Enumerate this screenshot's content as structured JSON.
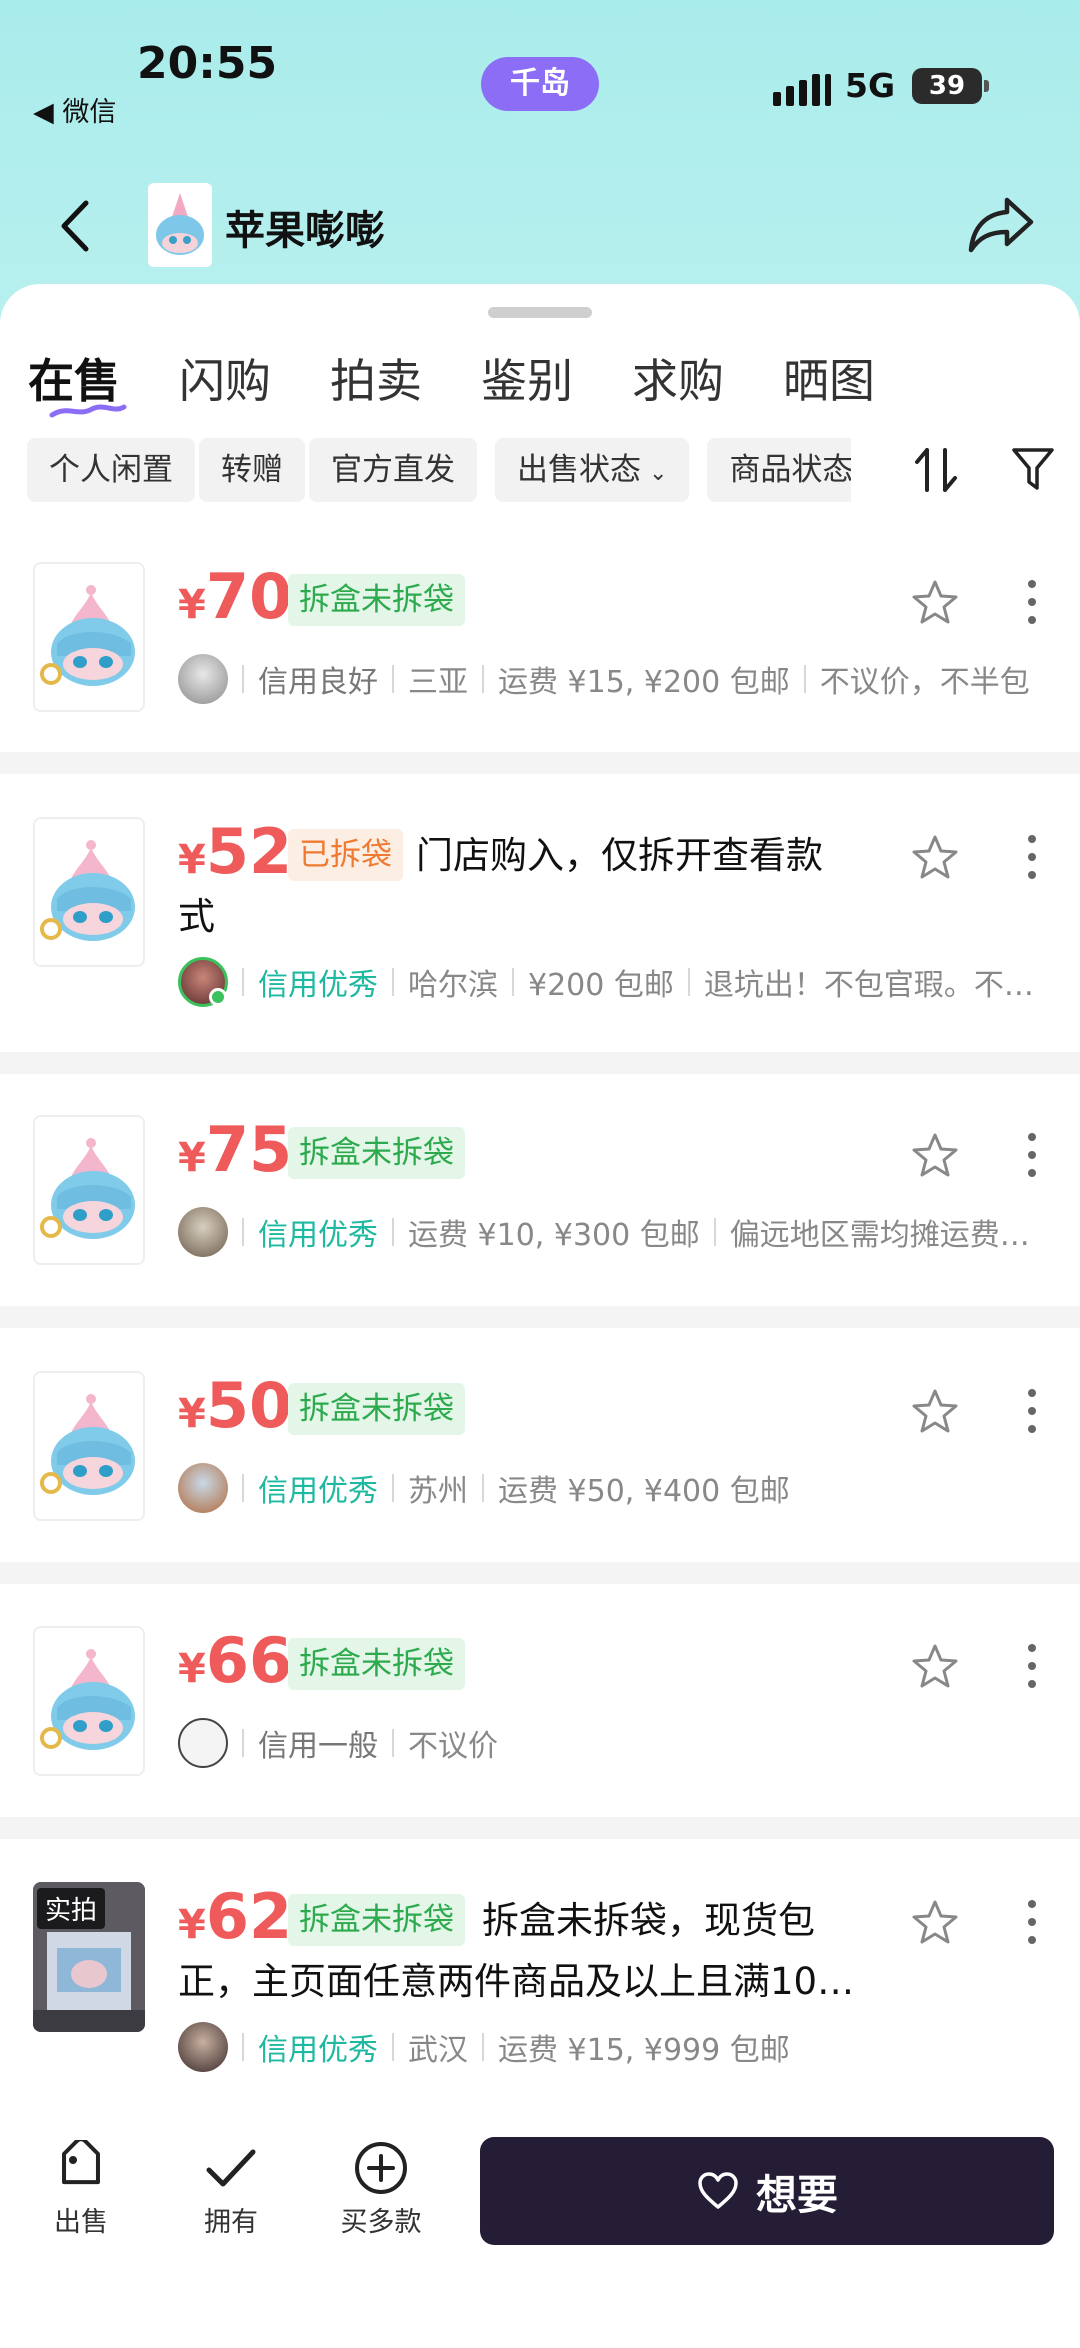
{
  "status_bar": {
    "time": "20:55",
    "back_app": "◀ 微信",
    "island_label": "千岛",
    "network": "5G",
    "battery": "39"
  },
  "nav": {
    "title": "苹果嘭嘭",
    "back_icon": "chevron-left-icon",
    "share_icon": "share-icon"
  },
  "tabs": [
    {
      "label": "在售",
      "active": true
    },
    {
      "label": "闪购"
    },
    {
      "label": "拍卖"
    },
    {
      "label": "鉴别"
    },
    {
      "label": "求购"
    },
    {
      "label": "晒图"
    }
  ],
  "filters": [
    {
      "label": "个人闲置"
    },
    {
      "label": "转赠"
    },
    {
      "label": "官方直发"
    },
    {
      "label": "出售状态",
      "caret": "⌄"
    },
    {
      "label": "商品状态"
    }
  ],
  "listings": [
    {
      "yen": "¥",
      "price": "70",
      "tag": "拆盒未拆袋",
      "tag_color": "#2eaa4e",
      "description": "",
      "credit": "信用良好",
      "meta": [
        "三亚",
        "运费 ¥15, ¥200 包邮",
        "不议价，不半包"
      ]
    },
    {
      "yen": "¥",
      "price": "52",
      "tag": "已拆袋",
      "tag_color": "#ef7a33",
      "description_line1": "门店购入，仅拆开查看款",
      "description_line2": "式",
      "credit": "信用优秀",
      "meta": [
        "哈尔滨",
        "¥200 包邮",
        "退坑出！不包官瑕。不…"
      ]
    },
    {
      "yen": "¥",
      "price": "75",
      "tag": "拆盒未拆袋",
      "credit": "信用优秀",
      "meta": [
        "运费 ¥10, ¥300 包邮",
        "偏远地区需均摊运费，…"
      ]
    },
    {
      "yen": "¥",
      "price": "50",
      "tag": "拆盒未拆袋",
      "credit": "信用优秀",
      "meta": [
        "苏州",
        "运费 ¥50, ¥400 包邮"
      ]
    },
    {
      "yen": "¥",
      "price": "66",
      "tag": "拆盒未拆袋",
      "credit": "信用一般",
      "meta": [
        "不议价"
      ]
    },
    {
      "yen": "¥",
      "price": "62",
      "tag": "拆盒未拆袋",
      "photo_badge": "实拍",
      "description_line1": "拆盒未拆袋，现货包",
      "description_line2": "正，主页面任意两件商品及以上且满10…",
      "credit": "信用优秀",
      "meta": [
        "武汉",
        "运费 ¥15, ¥999 包邮"
      ]
    }
  ],
  "bottom_bar": {
    "sell": "出售",
    "own": "拥有",
    "buy_more": "买多款",
    "want": "想要"
  },
  "colors": {
    "header_bg": "#a9ecec",
    "price": "#ef5a5a",
    "tag_green": "#2eaa4e",
    "tag_orange": "#ef7a33",
    "credit_good": "#1fb8a0",
    "want_button": "#241d35",
    "island": "#8b6df6"
  }
}
